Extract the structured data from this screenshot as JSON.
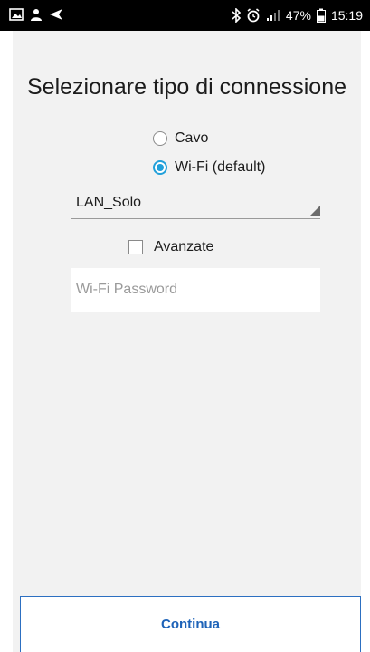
{
  "status_bar": {
    "icons_left": [
      "image-icon",
      "user-sync-icon",
      "send-icon"
    ],
    "icons_right": [
      "bluetooth-icon",
      "alarm-icon",
      "signal-icon",
      "battery-icon"
    ],
    "battery": "47%",
    "time": "15:19"
  },
  "screen": {
    "title": "Selezionare tipo di connessione",
    "options": [
      {
        "label": "Cavo",
        "selected": false
      },
      {
        "label": "Wi-Fi (default)",
        "selected": true
      }
    ],
    "network_select": {
      "value": "LAN_Solo"
    },
    "advanced": {
      "label": "Avanzate",
      "checked": false
    },
    "password": {
      "placeholder": "Wi-Fi Password",
      "value": ""
    },
    "continue_label": "Continua"
  },
  "colors": {
    "accent": "#21a0da",
    "button_text": "#1e63b8",
    "background": "#f2f2f2"
  }
}
